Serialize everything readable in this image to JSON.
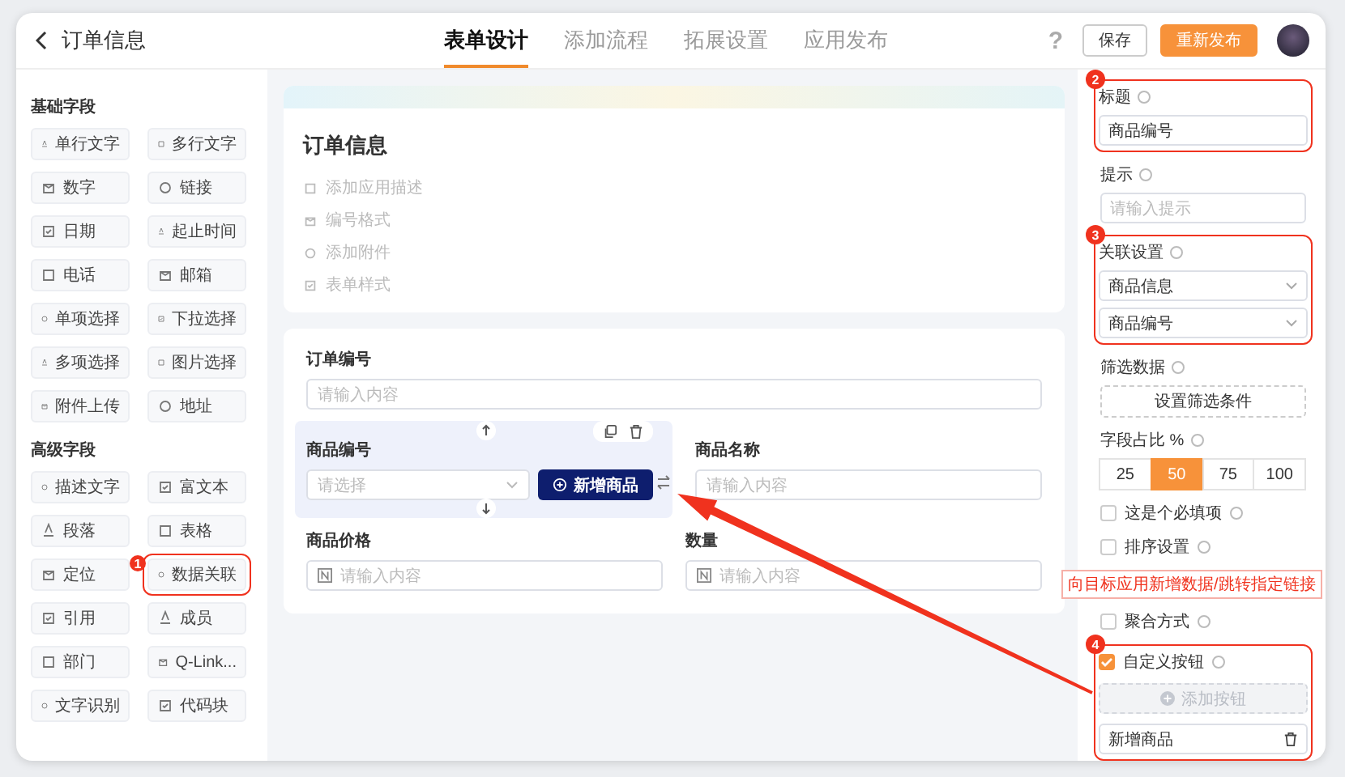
{
  "header": {
    "title": "订单信息"
  },
  "tabs": [
    {
      "label": "表单设计",
      "selected": true
    },
    {
      "label": "添加流程",
      "selected": false
    },
    {
      "label": "拓展设置",
      "selected": false
    },
    {
      "label": "应用发布",
      "selected": false
    }
  ],
  "help": "?",
  "buttons": [
    {
      "label": "保存",
      "kind": "secondary"
    },
    {
      "label": "重新发布",
      "kind": "primary"
    }
  ],
  "palette": [
    {
      "title": "基础字段",
      "items": [
        {
          "label": "单行文字"
        },
        {
          "label": "多行文字"
        },
        {
          "label": "数字"
        },
        {
          "label": "链接"
        },
        {
          "label": "日期"
        },
        {
          "label": "起止时间"
        },
        {
          "label": "电话"
        },
        {
          "label": "邮箱"
        },
        {
          "label": "单项选择"
        },
        {
          "label": "下拉选择"
        },
        {
          "label": "多项选择"
        },
        {
          "label": "图片选择"
        },
        {
          "label": "附件上传"
        },
        {
          "label": "地址"
        }
      ]
    },
    {
      "title": "高级字段",
      "items": [
        {
          "label": "描述文字"
        },
        {
          "label": "富文本"
        },
        {
          "label": "段落"
        },
        {
          "label": "表格"
        },
        {
          "label": "定位"
        },
        {
          "label": "数据关联",
          "badge": "1"
        },
        {
          "label": "引用"
        },
        {
          "label": "成员"
        },
        {
          "label": "部门"
        },
        {
          "label": "Q-Link..."
        },
        {
          "label": "文字识别"
        },
        {
          "label": "代码块"
        }
      ]
    }
  ],
  "form_header": {
    "title": "订单信息",
    "links": [
      "添加应用描述",
      "编号格式",
      "添加附件",
      "表单样式"
    ]
  },
  "form": {
    "rows": [
      [
        {
          "label": "订单编号",
          "kind": "text",
          "placeholder": "请输入内容",
          "selected": false
        }
      ],
      [
        {
          "label": "商品编号",
          "kind": "relation",
          "placeholder": "请选择",
          "button": "新增商品",
          "selected": true
        },
        {
          "label": "商品名称",
          "kind": "text",
          "placeholder": "请输入内容",
          "selected": false
        }
      ],
      [
        {
          "label": "商品价格",
          "kind": "number",
          "placeholder": "请输入内容",
          "selected": false
        },
        {
          "label": "数量",
          "kind": "number",
          "placeholder": "请输入内容",
          "selected": false
        }
      ]
    ]
  },
  "settings": {
    "title_field": {
      "label": "标题",
      "value": "商品编号",
      "badge": "2"
    },
    "hint_field": {
      "label": "提示",
      "placeholder": "请输入提示"
    },
    "relation": {
      "label": "关联设置",
      "selects": [
        "商品信息",
        "商品编号"
      ],
      "badge": "3"
    },
    "filter": {
      "label": "筛选数据",
      "button": "设置筛选条件"
    },
    "width": {
      "label": "字段占比 %",
      "options": [
        {
          "label": "25",
          "selected": false
        },
        {
          "label": "50",
          "selected": true
        },
        {
          "label": "75",
          "selected": false
        },
        {
          "label": "100",
          "selected": false
        }
      ]
    },
    "checkboxes": [
      {
        "label": "这是个必填项",
        "checked": false
      },
      {
        "label": "排序设置",
        "checked": false
      },
      {
        "label": "聚合方式",
        "checked": false
      }
    ],
    "custom_buttons": {
      "label": "自定义按钮",
      "checked": true,
      "badge": "4",
      "add": {
        "label": "添加按钮",
        "disabled": true
      },
      "items": [
        "新增商品"
      ]
    }
  },
  "callout": "向目标应用新增数据/跳转指定链接"
}
